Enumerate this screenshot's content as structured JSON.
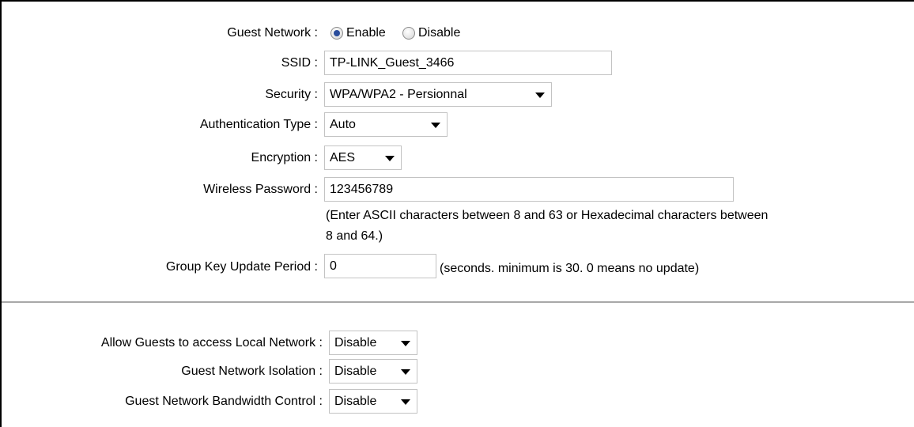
{
  "guest_network": {
    "label": "Guest Network :",
    "options": [
      "Enable",
      "Disable"
    ],
    "selected": "Enable"
  },
  "ssid": {
    "label": "SSID :",
    "value": "TP-LINK_Guest_3466"
  },
  "security": {
    "label": "Security :",
    "value": "WPA/WPA2 - Persionnal"
  },
  "auth_type": {
    "label": "Authentication Type :",
    "value": "Auto"
  },
  "encryption": {
    "label": "Encryption :",
    "value": "AES"
  },
  "password": {
    "label": "Wireless Password :",
    "value": "123456789",
    "hint_line1": "(Enter ASCII characters between 8 and 63 or Hexadecimal characters between",
    "hint_line2": "8 and 64.)"
  },
  "group_key": {
    "label": "Group Key Update Period :",
    "value": "0",
    "hint": "(seconds. minimum is 30. 0 means no update)"
  },
  "local_access": {
    "label": "Allow Guests to access Local Network :",
    "value": "Disable"
  },
  "isolation": {
    "label": "Guest Network Isolation :",
    "value": "Disable"
  },
  "bandwidth": {
    "label": "Guest Network Bandwidth Control :",
    "value": "Disable"
  },
  "icons": {
    "select_arrow": "chevron-down-icon",
    "radio_selected": "radio-selected-icon",
    "radio_unselected": "radio-unselected-icon"
  },
  "colors": {
    "radio_selected_dot": "#2a4d9c",
    "field_border": "#c3c3c3",
    "divider": "#a8a8a8"
  }
}
